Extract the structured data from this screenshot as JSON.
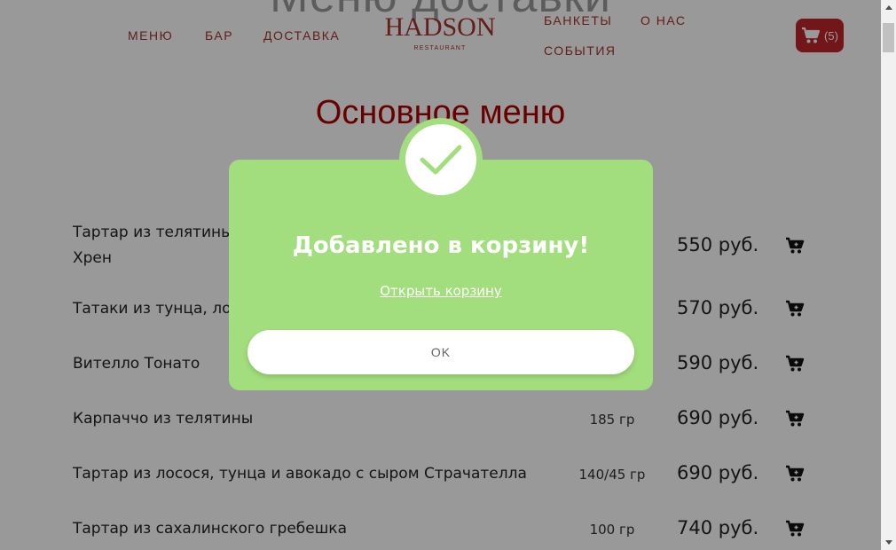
{
  "page": {
    "ghost_title": "Меню доставки"
  },
  "nav": {
    "menu": "МЕНЮ",
    "bar": "БАР",
    "delivery": "ДОСТАВКА",
    "banquets": "БАНКЕТЫ",
    "about": "О НАС",
    "events": "СОБЫТИЯ"
  },
  "logo": {
    "main": "HADSON",
    "sub": "RESTAURANT"
  },
  "cart": {
    "count": "(5)",
    "icon": "cart-icon"
  },
  "section": {
    "title": "Основное меню"
  },
  "menu_items": [
    {
      "name_line1": "Тартар из телятины",
      "name_line2": "Хрен",
      "weight": "",
      "price": "550 руб."
    },
    {
      "name_line1": "Татаки из тунца, лос",
      "name_line2": "",
      "weight": "",
      "price": "570 руб."
    },
    {
      "name_line1": "Вителло Тонато",
      "name_line2": "",
      "weight": "",
      "price": "590 руб."
    },
    {
      "name_line1": "Карпаччо из телятины",
      "name_line2": "",
      "weight": "185 гр",
      "price": "690 руб."
    },
    {
      "name_line1": "Тартар из лосося, тунца и авокадо с сыром Страчателла",
      "name_line2": "",
      "weight": "140/45 гр",
      "price": "690 руб."
    },
    {
      "name_line1": "Тартар из сахалинского гребешка",
      "name_line2": "",
      "weight": "100 гр",
      "price": "740 руб."
    }
  ],
  "modal": {
    "title": "Добавлено в корзину!",
    "link": "Открыть корзину",
    "ok": "OK",
    "icon": "checkmark-icon"
  },
  "colors": {
    "accent": "#a7322c",
    "cart_bg": "#c0262b",
    "section_title": "#b00000",
    "modal_bg": "#a2de7d"
  }
}
